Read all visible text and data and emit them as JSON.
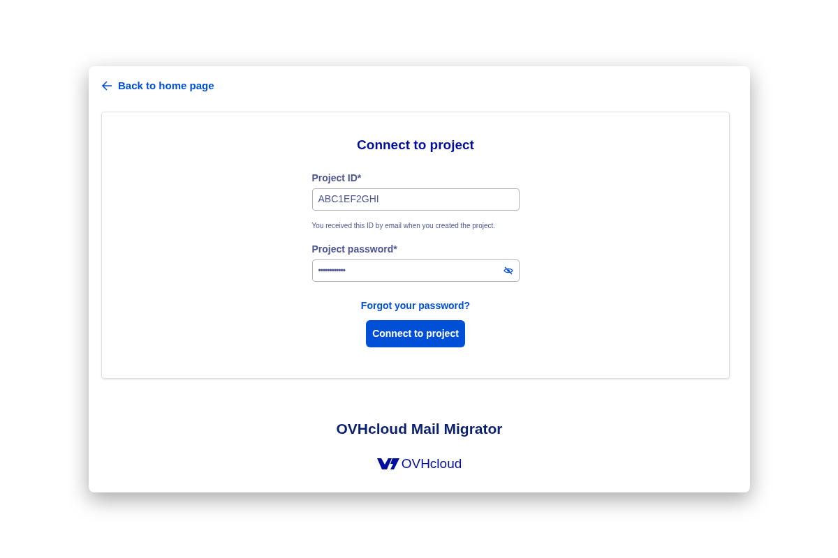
{
  "back_link": {
    "label": "Back to home page"
  },
  "form": {
    "title": "Connect to project",
    "fields": [
      {
        "kind": "text",
        "label": "Project ID*",
        "value": "ABC1EF2GHI",
        "help": "You received this ID by email when you created the project."
      },
      {
        "kind": "password",
        "label": "Project password*",
        "value": "••••••••••••"
      }
    ],
    "forgot_link": "Forgot your password?",
    "submit": "Connect to project"
  },
  "footer": {
    "title": "OVHcloud Mail Migrator",
    "logo_text": "OVHcloud"
  }
}
